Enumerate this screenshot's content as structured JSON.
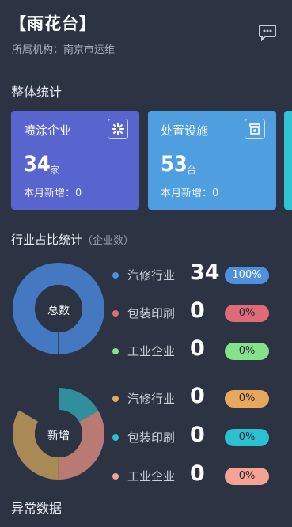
{
  "header": {
    "title": "【雨花台】",
    "org": "所属机构：南京市运维",
    "message_icon": "chat-bubble-icon"
  },
  "overall": {
    "section_title": "整体统计",
    "cards": [
      {
        "label": "喷涂企业",
        "value": "34",
        "unit": "家",
        "sub": "本月新增：0",
        "icon": "spray-icon",
        "color": "#5965cf"
      },
      {
        "label": "处置设施",
        "value": "53",
        "unit": "台",
        "sub": "本月新增：0",
        "icon": "facility-icon",
        "color": "#4f9fe0"
      }
    ]
  },
  "industry": {
    "section_title": "行业占比统计",
    "section_hint": "（企业数）",
    "total_chart": {
      "center_label": "总数",
      "items": [
        {
          "name": "汽修行业",
          "value": "34",
          "percent": "100%",
          "dot_color": "#4e8fe0",
          "badge_color": "#4e8fe0"
        },
        {
          "name": "包装印刷",
          "value": "0",
          "percent": "0%",
          "dot_color": "#e06b78",
          "badge_color": "#e06b78"
        },
        {
          "name": "工业企业",
          "value": "0",
          "percent": "0%",
          "dot_color": "#86e28a",
          "badge_color": "#86e28a"
        }
      ]
    },
    "new_chart": {
      "center_label": "新增",
      "items": [
        {
          "name": "汽修行业",
          "value": "0",
          "percent": "0%",
          "dot_color": "#e8a85c",
          "badge_color": "#e8a85c"
        },
        {
          "name": "包装印刷",
          "value": "0",
          "percent": "0%",
          "dot_color": "#2bc1d0",
          "badge_color": "#2bc1d0"
        },
        {
          "name": "工业企业",
          "value": "0",
          "percent": "0%",
          "dot_color": "#f4a293",
          "badge_color": "#f4a293"
        }
      ]
    }
  },
  "abnormal": {
    "section_title": "异常数据"
  }
}
